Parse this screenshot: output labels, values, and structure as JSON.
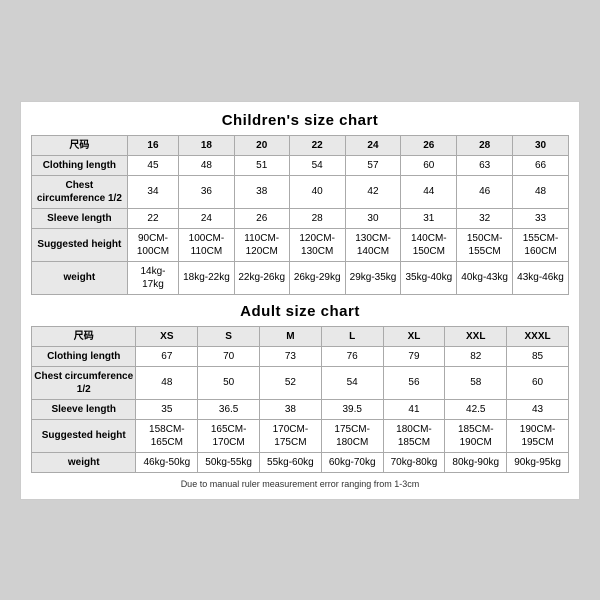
{
  "children_chart": {
    "title": "Children's size chart",
    "columns": [
      "尺码",
      "16",
      "18",
      "20",
      "22",
      "24",
      "26",
      "28",
      "30"
    ],
    "rows": [
      {
        "label": "Clothing length",
        "values": [
          "45",
          "48",
          "51",
          "54",
          "57",
          "60",
          "63",
          "66"
        ]
      },
      {
        "label": "Chest circumference 1/2",
        "values": [
          "34",
          "36",
          "38",
          "40",
          "42",
          "44",
          "46",
          "48"
        ]
      },
      {
        "label": "Sleeve length",
        "values": [
          "22",
          "24",
          "26",
          "28",
          "30",
          "31",
          "32",
          "33"
        ]
      },
      {
        "label": "Suggested height",
        "values": [
          "90CM-100CM",
          "100CM-110CM",
          "110CM-120CM",
          "120CM-130CM",
          "130CM-140CM",
          "140CM-150CM",
          "150CM-155CM",
          "155CM-160CM"
        ]
      },
      {
        "label": "weight",
        "values": [
          "14kg-17kg",
          "18kg-22kg",
          "22kg-26kg",
          "26kg-29kg",
          "29kg-35kg",
          "35kg-40kg",
          "40kg-43kg",
          "43kg-46kg"
        ]
      }
    ]
  },
  "adult_chart": {
    "title": "Adult size chart",
    "columns": [
      "尺码",
      "XS",
      "S",
      "M",
      "L",
      "XL",
      "XXL",
      "XXXL"
    ],
    "rows": [
      {
        "label": "Clothing length",
        "values": [
          "67",
          "70",
          "73",
          "76",
          "79",
          "82",
          "85"
        ]
      },
      {
        "label": "Chest circumference 1/2",
        "values": [
          "48",
          "50",
          "52",
          "54",
          "56",
          "58",
          "60"
        ]
      },
      {
        "label": "Sleeve length",
        "values": [
          "35",
          "36.5",
          "38",
          "39.5",
          "41",
          "42.5",
          "43"
        ]
      },
      {
        "label": "Suggested height",
        "values": [
          "158CM-165CM",
          "165CM-170CM",
          "170CM-175CM",
          "175CM-180CM",
          "180CM-185CM",
          "185CM-190CM",
          "190CM-195CM"
        ]
      },
      {
        "label": "weight",
        "values": [
          "46kg-50kg",
          "50kg-55kg",
          "55kg-60kg",
          "60kg-70kg",
          "70kg-80kg",
          "80kg-90kg",
          "90kg-95kg"
        ]
      }
    ]
  },
  "note": "Due to manual ruler measurement error ranging from 1-3cm"
}
